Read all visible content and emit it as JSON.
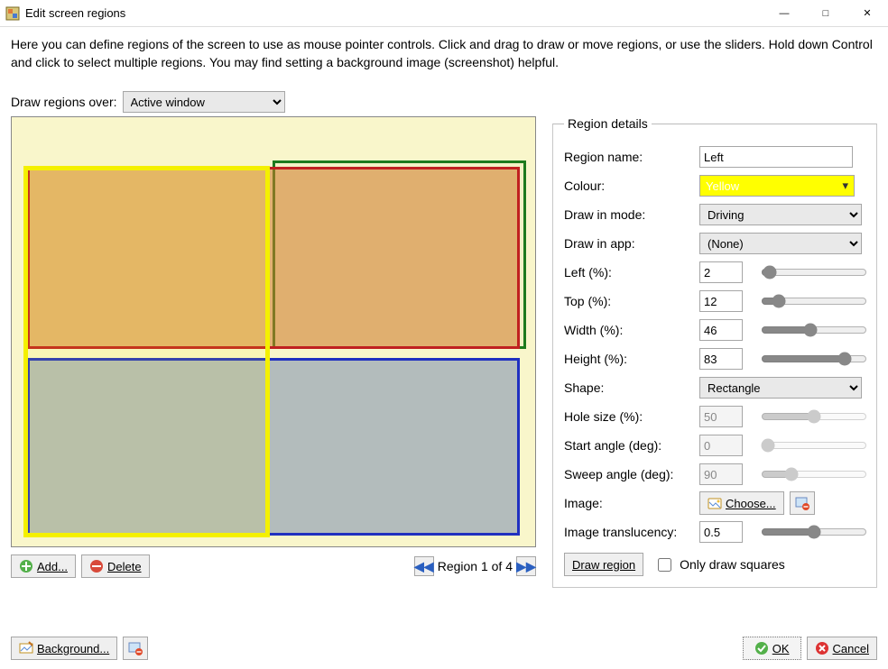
{
  "window": {
    "title": "Edit screen regions"
  },
  "instructions": "Here you can define regions of the screen to use as mouse pointer controls. Click and drag to draw or move regions, or use the sliders. Hold down Control and click to select multiple regions. You may find setting a background image (screenshot) helpful.",
  "draw_over": {
    "label": "Draw regions over:",
    "value": "Active window"
  },
  "toolbar": {
    "add": "Add...",
    "delete": "Delete",
    "pager": "Region 1 of 4"
  },
  "details": {
    "legend": "Region details",
    "name_label": "Region name:",
    "name_value": "Left",
    "colour_label": "Colour:",
    "colour_value": "Yellow",
    "mode_label": "Draw in mode:",
    "mode_value": "Driving",
    "app_label": "Draw in app:",
    "app_value": "(None)",
    "left_label": "Left (%):",
    "left_value": "2",
    "top_label": "Top (%):",
    "top_value": "12",
    "width_label": "Width (%):",
    "width_value": "46",
    "height_label": "Height (%):",
    "height_value": "83",
    "shape_label": "Shape:",
    "shape_value": "Rectangle",
    "hole_label": "Hole size (%):",
    "hole_value": "50",
    "start_label": "Start angle (deg):",
    "start_value": "0",
    "sweep_label": "Sweep angle (deg):",
    "sweep_value": "90",
    "image_label": "Image:",
    "choose_label": "Choose...",
    "transl_label": "Image translucency:",
    "transl_value": "0.5",
    "draw_region": "Draw region",
    "only_squares": "Only draw squares"
  },
  "footer": {
    "background": "Background...",
    "ok": "OK",
    "cancel": "Cancel"
  },
  "colors": {
    "yellow": "#ffff00",
    "red": "#c02020",
    "green": "#1d7a1d",
    "blue": "#2030c0"
  }
}
